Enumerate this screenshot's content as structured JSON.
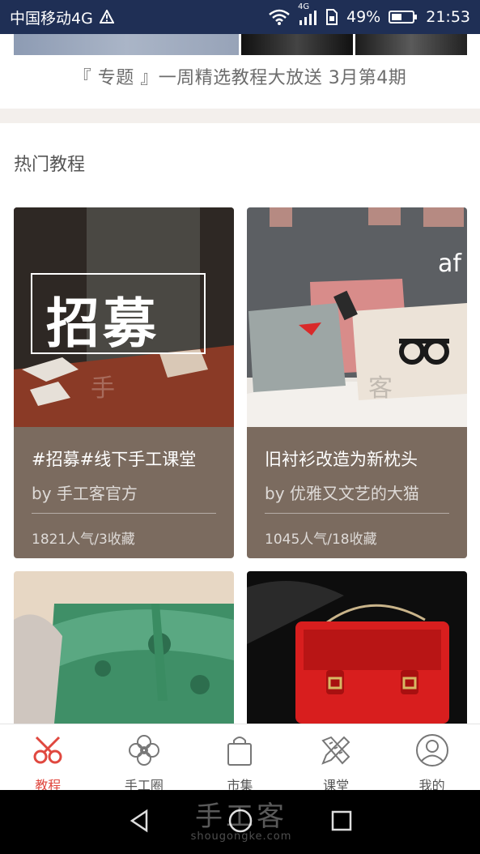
{
  "status_bar": {
    "carrier": "中国移动4G",
    "network": "4G",
    "battery": "49%",
    "time": "21:53"
  },
  "banner": {
    "caption": "『 专题 』一周精选教程大放送 3月第4期"
  },
  "section": {
    "title": "热门教程"
  },
  "cards": [
    {
      "title": "#招募#线下手工课堂",
      "author": "by 手工客官方",
      "stats": "1821人气/3收藏",
      "image_text": "招募",
      "watermark": "手"
    },
    {
      "title": "旧衬衫改造为新枕头",
      "author": "by 优雅又文艺的大猫",
      "stats": "1045人气/18收藏",
      "image_text": "af",
      "watermark": "客"
    }
  ],
  "bottom_nav": [
    {
      "label": "教程",
      "icon": "scissors-icon",
      "active": true
    },
    {
      "label": "手工圈",
      "icon": "flower-icon",
      "active": false
    },
    {
      "label": "市集",
      "icon": "shopping-bag-icon",
      "active": false
    },
    {
      "label": "课堂",
      "icon": "pencil-ruler-icon",
      "active": false
    },
    {
      "label": "我的",
      "icon": "user-icon",
      "active": false
    }
  ],
  "watermark": {
    "brand": "手工客",
    "url": "shougongke.com"
  },
  "colors": {
    "accent": "#e0483f",
    "card_info": "#7b6b5f",
    "status_bar": "#1f2f55"
  }
}
